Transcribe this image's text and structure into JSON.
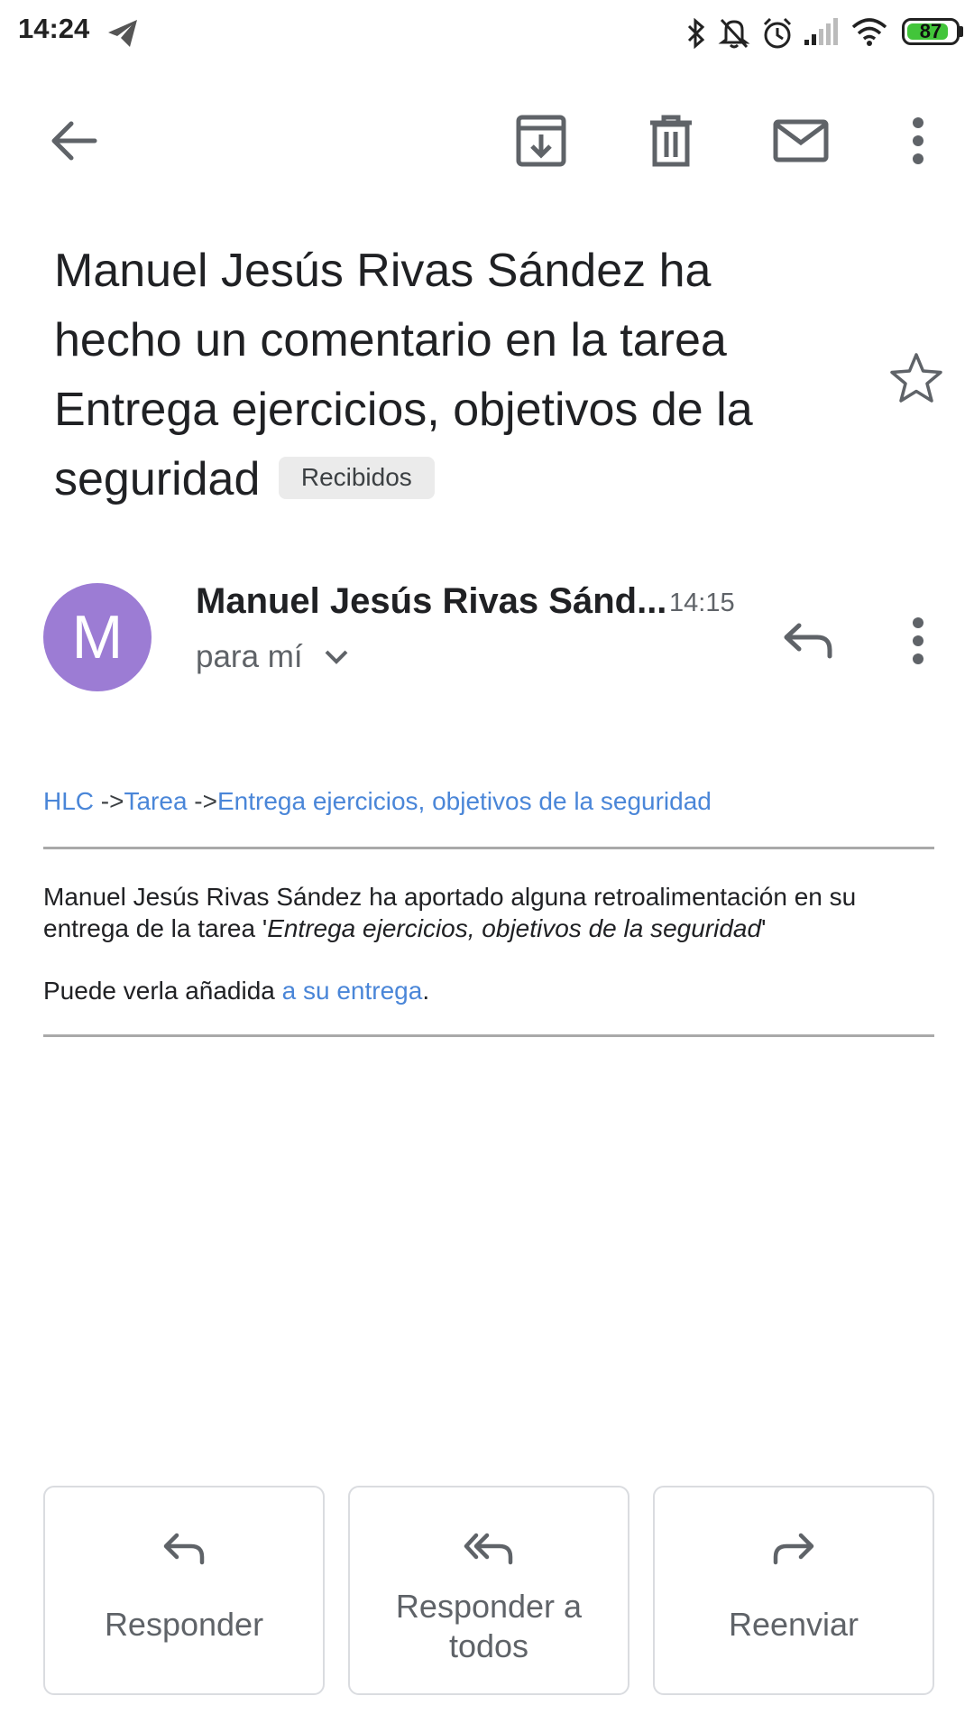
{
  "status_bar": {
    "time": "14:24",
    "battery": "87",
    "battery_fraction": 0.87,
    "icons": [
      "telegram-icon",
      "bluetooth-icon",
      "mute-icon",
      "alarm-icon",
      "signal-icon",
      "wifi-icon",
      "battery-icon"
    ]
  },
  "toolbar": {
    "icons": [
      "back-arrow-icon",
      "archive-icon",
      "delete-icon",
      "mark-unread-icon",
      "more-vert-icon"
    ]
  },
  "email": {
    "subject": "Manuel Jesús Rivas Sández ha hecho un comentario en la tarea Entrega ejercicios, objetivos de la seguridad",
    "label_chip": "Recibidos",
    "sender_initial": "M",
    "avatar_color": "#9c7cd4",
    "sender_name": "Manuel Jesús Rivas Sánd...",
    "time": "14:15",
    "recipient": "para mí"
  },
  "body": {
    "breadcrumb": {
      "course": "HLC",
      "sep1": " ->",
      "module": "Tarea",
      "sep2": " ->",
      "assignment": "Entrega ejercicios, objetivos de la seguridad"
    },
    "para_start": "Manuel Jesús Rivas Sández ha aportado alguna retroalimentación en su entrega de la tarea '",
    "para_italic": "Entrega ejercicios, objetivos de la seguridad",
    "para_end": "'",
    "line2_start": "Puede verla añadida ",
    "line2_link": "a su entrega",
    "line2_end": ".",
    "link_color": "#4a86d8"
  },
  "actions": {
    "reply": "Responder",
    "reply_all_line1": "Responder a",
    "reply_all_line2": "todos",
    "forward": "Reenviar"
  }
}
